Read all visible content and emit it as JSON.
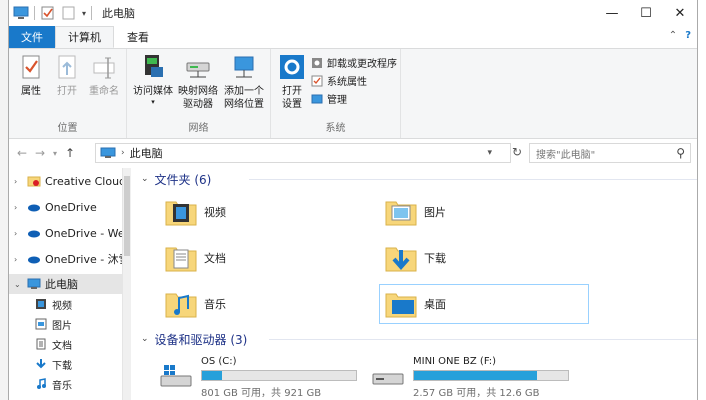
{
  "window": {
    "title": "此电脑",
    "controls": {
      "minimize": "—",
      "maximize": "☐",
      "close": "✕"
    }
  },
  "ribbon": {
    "tabs": [
      {
        "label": "文件"
      },
      {
        "label": "计算机"
      },
      {
        "label": "查看"
      }
    ],
    "location_group": {
      "label": "位置",
      "buttons": [
        "属性",
        "打开",
        "重命名"
      ]
    },
    "network_group": {
      "label": "网络",
      "buttons": [
        "访问媒体",
        "映射网络\n驱动器",
        "添加一个\n网络位置"
      ]
    },
    "system_group": {
      "label": "系统",
      "open_settings": "打开\n设置",
      "items": [
        "卸载或更改程序",
        "系统属性",
        "管理"
      ]
    }
  },
  "address": {
    "crumb": "此电脑",
    "search_placeholder": "搜索\"此电脑\""
  },
  "nav": {
    "items": [
      {
        "label": "Creative Cloud 文"
      },
      {
        "label": "OneDrive"
      },
      {
        "label": "OneDrive - Wen"
      },
      {
        "label": "OneDrive - 沐雪"
      },
      {
        "label": "此电脑"
      }
    ],
    "sub_items": [
      "视频",
      "图片",
      "文档",
      "下载",
      "音乐"
    ]
  },
  "content": {
    "folders_header": "文件夹 (6)",
    "folders": [
      "视频",
      "图片",
      "文档",
      "下载",
      "音乐",
      "桌面"
    ],
    "devices_header": "设备和驱动器 (3)",
    "drives": [
      {
        "name": "OS (C:)",
        "size": "801 GB 可用，共 921 GB",
        "used_fraction": 0.13
      },
      {
        "name": "MINI ONE BZ (F:)",
        "size": "2.57 GB 可用，共 12.6 GB",
        "used_fraction": 0.8
      }
    ]
  },
  "colors": {
    "file_tab": "#1979ca",
    "section_header": "#1e3287",
    "drive_bar": "#26a0da",
    "folder_yellow": "#f7d67a"
  }
}
